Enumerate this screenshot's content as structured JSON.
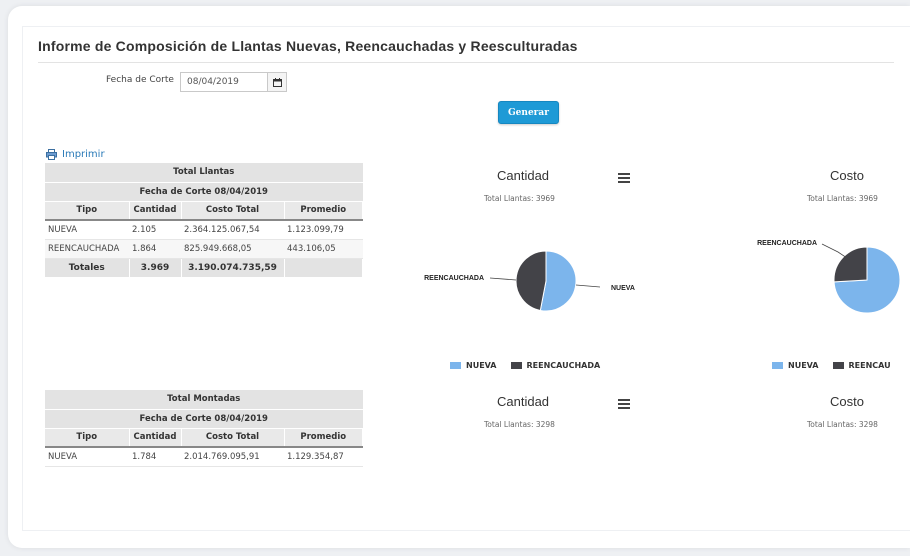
{
  "header": {
    "title": "Informe de Composición de Llantas Nuevas, Reencauchadas y Reesculturadas"
  },
  "filter": {
    "fecha_label": "Fecha de Corte",
    "fecha_value": "08/04/2019"
  },
  "actions": {
    "generar_label": "Generar",
    "imprimir_label": "Imprimir"
  },
  "colors": {
    "nueva": "#7cb5ec",
    "reencauchada": "#434348",
    "accent": "#1e9ad6"
  },
  "table_llantas": {
    "title": "Total Llantas",
    "subtitle": "Fecha de Corte 08/04/2019",
    "columns": [
      "Tipo",
      "Cantidad",
      "Costo Total",
      "Promedio"
    ],
    "rows": [
      [
        "NUEVA",
        "2.105",
        "2.364.125.067,54",
        "1.123.099,79"
      ],
      [
        "REENCAUCHADA",
        "1.864",
        "825.949.668,05",
        "443.106,05"
      ]
    ],
    "totals": [
      "Totales",
      "3.969",
      "3.190.074.735,59",
      ""
    ]
  },
  "table_montadas": {
    "title": "Total Montadas",
    "subtitle": "Fecha de Corte 08/04/2019",
    "columns": [
      "Tipo",
      "Cantidad",
      "Costo Total",
      "Promedio"
    ],
    "rows": [
      [
        "NUEVA",
        "1.784",
        "2.014.769.095,91",
        "1.129.354,87"
      ]
    ]
  },
  "charts": {
    "cantidad_1": {
      "title": "Cantidad",
      "subtitle": "Total Llantas: 3969"
    },
    "costo_1": {
      "title": "Costo",
      "subtitle": "Total Llantas: 3969"
    },
    "cantidad_2": {
      "title": "Cantidad",
      "subtitle": "Total Llantas: 3298"
    },
    "costo_2": {
      "title": "Costo",
      "subtitle": "Total Llantas: 3298"
    },
    "legend_full": [
      "NUEVA",
      "REENCAUCHADA"
    ],
    "legend_cut": [
      "NUEVA",
      "REENCAU"
    ],
    "label_nueva": "NUEVA",
    "label_reencauchada": "REENCAUCHADA"
  },
  "chart_data": [
    {
      "type": "pie",
      "title": "Cantidad",
      "subtitle": "Total Llantas: 3969",
      "categories": [
        "NUEVA",
        "REENCAUCHADA"
      ],
      "values": [
        2105,
        1864
      ],
      "legend": "bottom"
    },
    {
      "type": "pie",
      "title": "Costo",
      "subtitle": "Total Llantas: 3969",
      "categories": [
        "NUEVA",
        "REENCAUCHADA"
      ],
      "values": [
        2364125067.54,
        825949668.05
      ],
      "legend": "bottom"
    }
  ]
}
